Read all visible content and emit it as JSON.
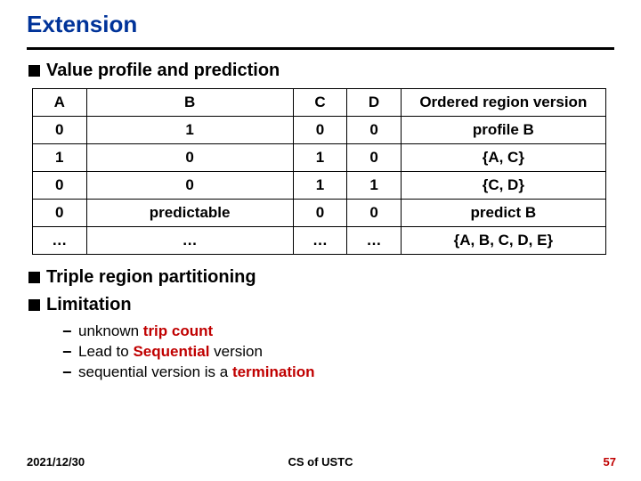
{
  "title": "Extension",
  "bullets": {
    "b1": "Value profile and prediction",
    "b2": "Triple region partitioning",
    "b3": "Limitation"
  },
  "sub": {
    "s1_pre": "unknown ",
    "s1_accent": "trip count",
    "s2_pre": "Lead to ",
    "s2_accent": "Sequential",
    "s2_post": " version",
    "s3_pre": "sequential version is a ",
    "s3_accent": "termination"
  },
  "chart_data": {
    "type": "table",
    "headers": [
      "A",
      "B",
      "C",
      "D",
      "Ordered region version"
    ],
    "rows": [
      [
        "0",
        "1",
        "0",
        "0",
        "profile B"
      ],
      [
        "1",
        "0",
        "1",
        "0",
        "{A, C}"
      ],
      [
        "0",
        "0",
        "1",
        "1",
        "{C, D}"
      ],
      [
        "0",
        "predictable",
        "0",
        "0",
        "predict B"
      ],
      [
        "…",
        "…",
        "…",
        "…",
        "{A, B, C, D, E}"
      ]
    ]
  },
  "footer": {
    "date": "2021/12/30",
    "center": "CS of USTC",
    "page": "57"
  }
}
